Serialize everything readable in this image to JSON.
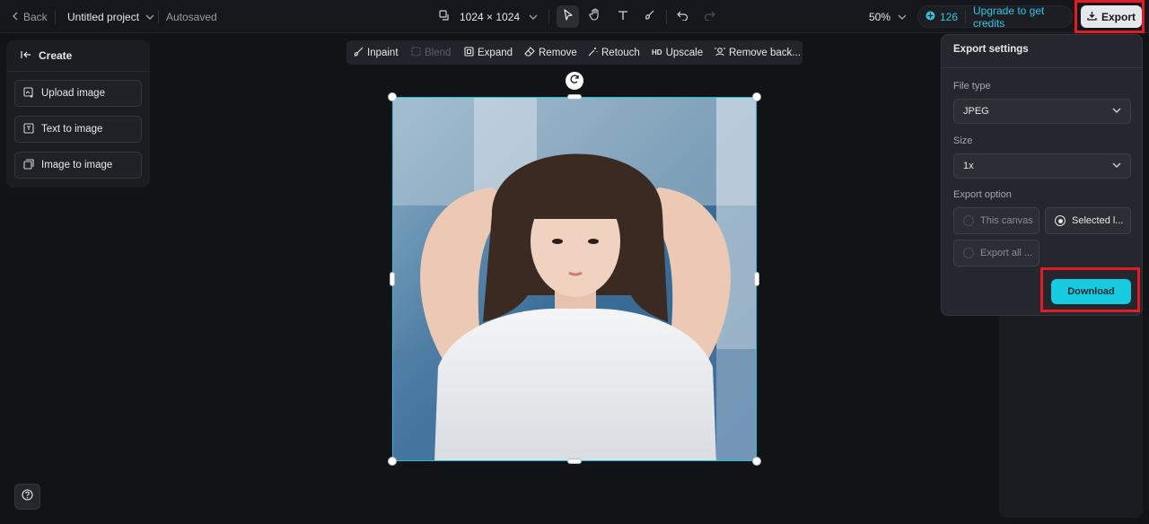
{
  "topbar": {
    "back_label": "Back",
    "project_title": "Untitled project",
    "save_status": "Autosaved",
    "canvas_size": "1024 × 1024",
    "zoom": "50%",
    "credits_count": "126",
    "upgrade_label": "Upgrade to get credits",
    "export_label": "Export"
  },
  "left_panel": {
    "header": "Create",
    "items": [
      {
        "label": "Upload image",
        "icon": "upload-image-icon"
      },
      {
        "label": "Text to image",
        "icon": "text-to-image-icon"
      },
      {
        "label": "Image to image",
        "icon": "image-to-image-icon"
      }
    ]
  },
  "edit_tools": {
    "inpaint": "Inpaint",
    "blend": "Blend",
    "expand": "Expand",
    "remove": "Remove",
    "retouch": "Retouch",
    "upscale_badge": "HD",
    "upscale": "Upscale",
    "remove_bg": "Remove back..."
  },
  "export_panel": {
    "title": "Export settings",
    "file_type_label": "File type",
    "file_type_value": "JPEG",
    "size_label": "Size",
    "size_value": "1x",
    "export_option_label": "Export option",
    "options": [
      {
        "label": "This canvas",
        "selected": false
      },
      {
        "label": "Selected l...",
        "selected": true
      },
      {
        "label": "Export all ...",
        "selected": false
      }
    ],
    "download_label": "Download"
  },
  "colors": {
    "accent": "#17cce0",
    "selection": "#20c3d6",
    "highlight": "#e21c24",
    "credits_text": "#2fc6e0"
  }
}
